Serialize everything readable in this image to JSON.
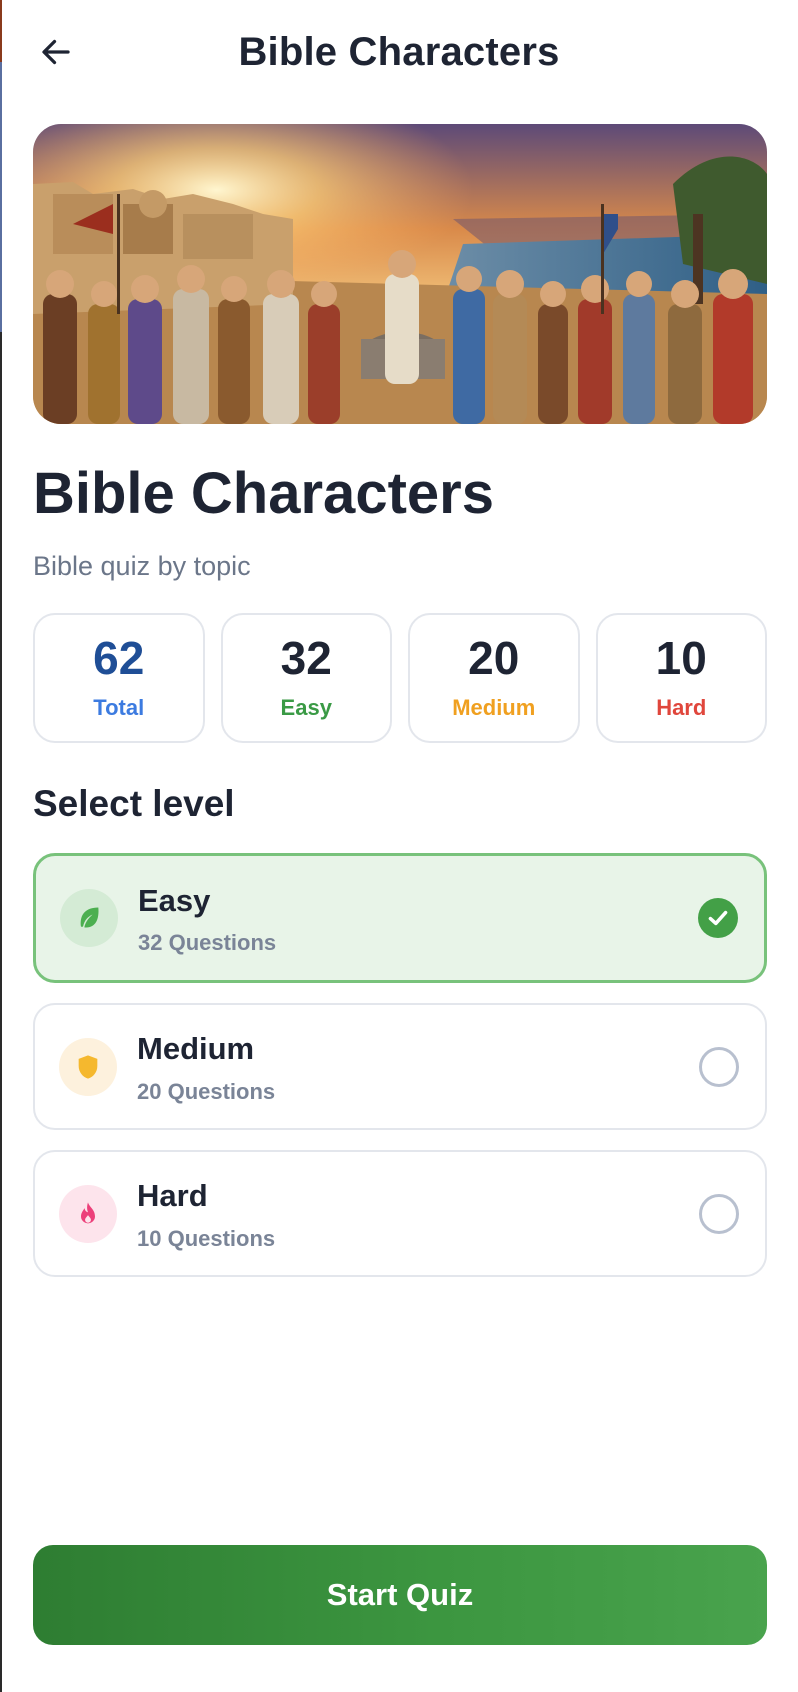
{
  "header": {
    "title": "Bible Characters",
    "back_icon": "arrow-left-icon"
  },
  "hero": {
    "image": "illustration of biblical characters gathered by a well at sunset near the sea"
  },
  "topic": {
    "title": "Bible Characters",
    "subtitle": "Bible quiz by topic"
  },
  "stats": [
    {
      "value": "62",
      "label": "Total",
      "value_color": "#1f4e96",
      "label_color": "#3c7be0"
    },
    {
      "value": "32",
      "label": "Easy",
      "value_color": "#1e2433",
      "label_color": "#3a9a45"
    },
    {
      "value": "20",
      "label": "Medium",
      "value_color": "#1e2433",
      "label_color": "#f0a020"
    },
    {
      "value": "10",
      "label": "Hard",
      "value_color": "#1e2433",
      "label_color": "#e0463c"
    }
  ],
  "levels_section": {
    "title": "Select level",
    "levels": [
      {
        "name": "Easy",
        "count": "32 Questions",
        "icon": "leaf-icon",
        "selected": true,
        "icon_color": "#4caf50",
        "badge_bg": "#d4ebd5"
      },
      {
        "name": "Medium",
        "count": "20 Questions",
        "icon": "shield-icon",
        "selected": false,
        "icon_color": "#f5b82e",
        "badge_bg": "#fdf1dd"
      },
      {
        "name": "Hard",
        "count": "10 Questions",
        "icon": "flame-icon",
        "selected": false,
        "icon_color": "#ec407a",
        "badge_bg": "#fde4ec"
      }
    ]
  },
  "actions": {
    "start_label": "Start Quiz"
  },
  "colors": {
    "accent": "#2e7d32",
    "selected_bg": "#e8f4e8",
    "selected_border": "#78c27b"
  }
}
